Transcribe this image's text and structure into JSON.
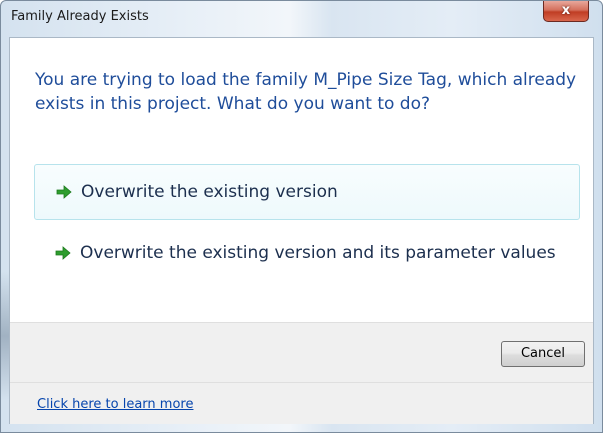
{
  "window": {
    "title": "Family Already Exists",
    "close_glyph": "x"
  },
  "main": {
    "instruction": "You are trying to load the family M_Pipe Size Tag, which already exists in this project.  What do you want to do?",
    "commands": [
      {
        "label": "Overwrite the existing version",
        "icon": "green-arrow-icon"
      },
      {
        "label": "Overwrite the existing version and its parameter values",
        "icon": "green-arrow-icon"
      }
    ]
  },
  "footer": {
    "cancel_label": "Cancel",
    "learn_more_link": "Click here to learn more"
  },
  "colors": {
    "instruction_text": "#1f4d9a",
    "command_text": "#1c2f4e",
    "arrow": "#2e9d2e",
    "link": "#0645ad",
    "close_button": "#c03d24"
  }
}
